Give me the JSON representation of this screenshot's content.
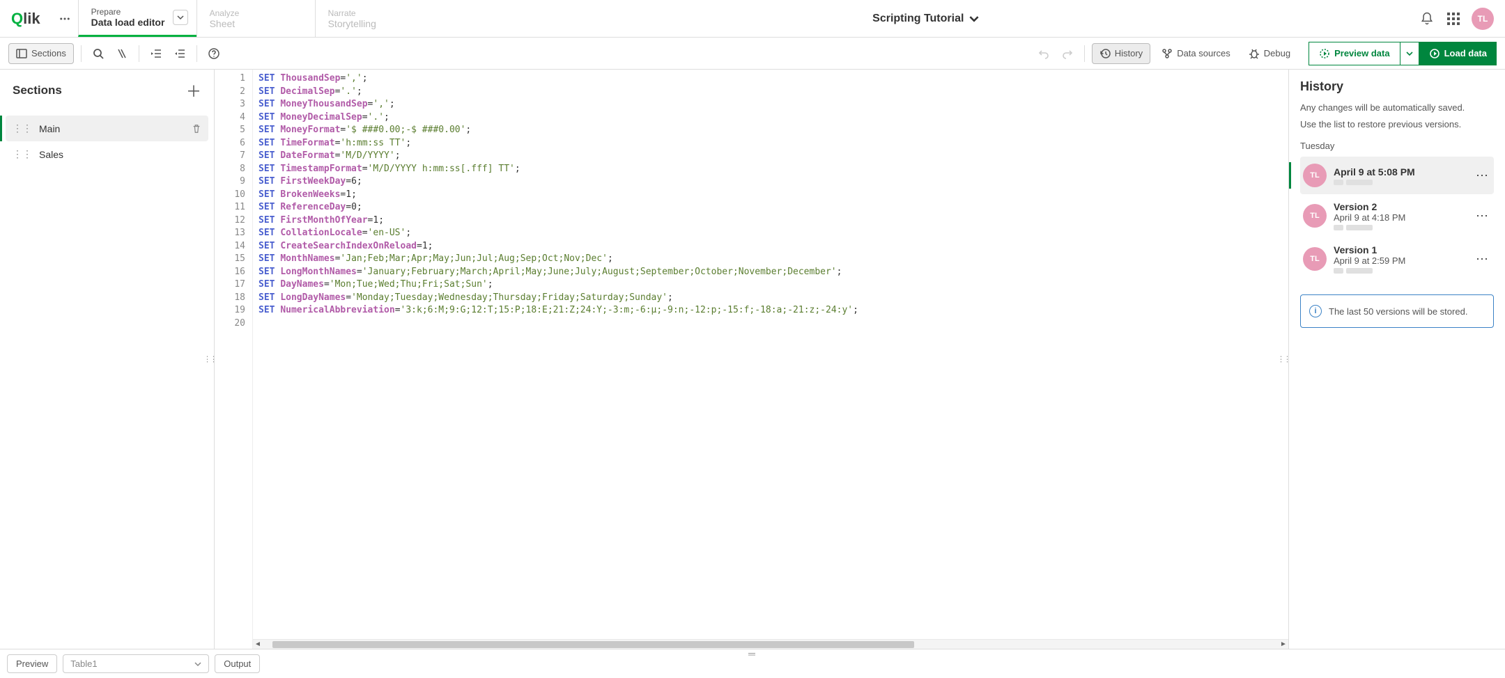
{
  "app": {
    "logo_text": "Qlik",
    "title": "Scripting Tutorial",
    "user_initials": "TL"
  },
  "nav": {
    "prepare": {
      "label": "Prepare",
      "sub": "Data load editor"
    },
    "analyze": {
      "label": "Analyze",
      "sub": "Sheet"
    },
    "narrate": {
      "label": "Narrate",
      "sub": "Storytelling"
    }
  },
  "toolbar": {
    "sections": "Sections",
    "history": "History",
    "data_sources": "Data sources",
    "debug": "Debug",
    "preview_data": "Preview data",
    "load_data": "Load data"
  },
  "sidebar": {
    "title": "Sections",
    "items": [
      {
        "label": "Main",
        "active": true
      },
      {
        "label": "Sales",
        "active": false
      }
    ]
  },
  "editor": {
    "lines": [
      {
        "n": 1,
        "kw": "SET",
        "var": "ThousandSep",
        "rest": "=",
        "str": "','",
        "tail": ";"
      },
      {
        "n": 2,
        "kw": "SET",
        "var": "DecimalSep",
        "rest": "=",
        "str": "'.'",
        "tail": ";"
      },
      {
        "n": 3,
        "kw": "SET",
        "var": "MoneyThousandSep",
        "rest": "=",
        "str": "','",
        "tail": ";"
      },
      {
        "n": 4,
        "kw": "SET",
        "var": "MoneyDecimalSep",
        "rest": "=",
        "str": "'.'",
        "tail": ";"
      },
      {
        "n": 5,
        "kw": "SET",
        "var": "MoneyFormat",
        "rest": "=",
        "str": "'$ ###0.00;-$ ###0.00'",
        "tail": ";"
      },
      {
        "n": 6,
        "kw": "SET",
        "var": "TimeFormat",
        "rest": "=",
        "str": "'h:mm:ss TT'",
        "tail": ";"
      },
      {
        "n": 7,
        "kw": "SET",
        "var": "DateFormat",
        "rest": "=",
        "str": "'M/D/YYYY'",
        "tail": ";"
      },
      {
        "n": 8,
        "kw": "SET",
        "var": "TimestampFormat",
        "rest": "=",
        "str": "'M/D/YYYY h:mm:ss[.fff] TT'",
        "tail": ";"
      },
      {
        "n": 9,
        "kw": "SET",
        "var": "FirstWeekDay",
        "rest": "=",
        "num": "6",
        "tail": ";"
      },
      {
        "n": 10,
        "kw": "SET",
        "var": "BrokenWeeks",
        "rest": "=",
        "num": "1",
        "tail": ";"
      },
      {
        "n": 11,
        "kw": "SET",
        "var": "ReferenceDay",
        "rest": "=",
        "num": "0",
        "tail": ";"
      },
      {
        "n": 12,
        "kw": "SET",
        "var": "FirstMonthOfYear",
        "rest": "=",
        "num": "1",
        "tail": ";"
      },
      {
        "n": 13,
        "kw": "SET",
        "var": "CollationLocale",
        "rest": "=",
        "str": "'en-US'",
        "tail": ";"
      },
      {
        "n": 14,
        "kw": "SET",
        "var": "CreateSearchIndexOnReload",
        "rest": "=",
        "num": "1",
        "tail": ";"
      },
      {
        "n": 15,
        "kw": "SET",
        "var": "MonthNames",
        "rest": "=",
        "str": "'Jan;Feb;Mar;Apr;May;Jun;Jul;Aug;Sep;Oct;Nov;Dec'",
        "tail": ";"
      },
      {
        "n": 16,
        "kw": "SET",
        "var": "LongMonthNames",
        "rest": "=",
        "str": "'January;February;March;April;May;June;July;August;September;October;November;December'",
        "tail": ";"
      },
      {
        "n": 17,
        "kw": "SET",
        "var": "DayNames",
        "rest": "=",
        "str": "'Mon;Tue;Wed;Thu;Fri;Sat;Sun'",
        "tail": ";"
      },
      {
        "n": 18,
        "kw": "SET",
        "var": "LongDayNames",
        "rest": "=",
        "str": "'Monday;Tuesday;Wednesday;Thursday;Friday;Saturday;Sunday'",
        "tail": ";"
      },
      {
        "n": 19,
        "kw": "SET",
        "var": "NumericalAbbreviation",
        "rest": "=",
        "str": "'3:k;6:M;9:G;12:T;15:P;18:E;21:Z;24:Y;-3:m;-6:μ;-9:n;-12:p;-15:f;-18:a;-21:z;-24:y'",
        "tail": ";"
      },
      {
        "n": 20
      }
    ]
  },
  "history": {
    "title": "History",
    "desc1": "Any changes will be automatically saved.",
    "desc2": "Use the list to restore previous versions.",
    "day": "Tuesday",
    "versions": [
      {
        "title": "April 9 at 5:08 PM",
        "time": "",
        "initials": "TL",
        "active": true
      },
      {
        "title": "Version 2",
        "time": "April 9 at 4:18 PM",
        "initials": "TL",
        "active": false
      },
      {
        "title": "Version 1",
        "time": "April 9 at 2:59 PM",
        "initials": "TL",
        "active": false
      }
    ],
    "info": "The last 50 versions will be stored."
  },
  "bottom": {
    "preview": "Preview",
    "table": "Table1",
    "output": "Output"
  }
}
